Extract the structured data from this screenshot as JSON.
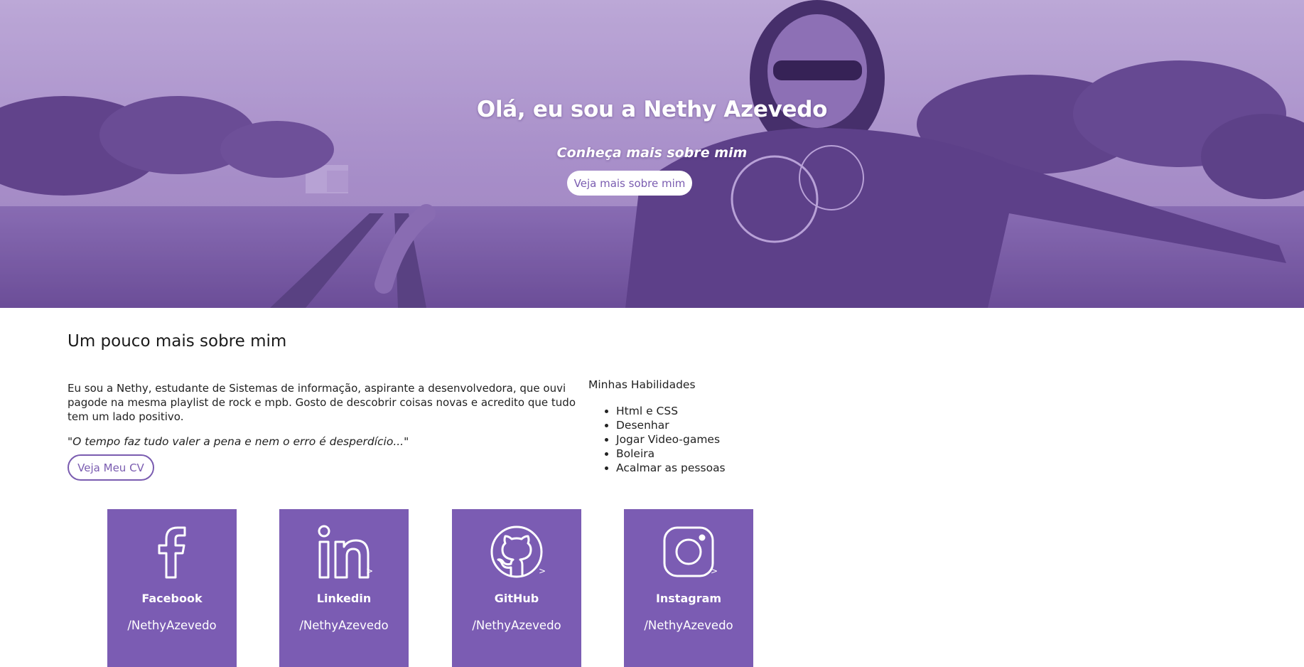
{
  "hero": {
    "title": "Olá, eu sou a Nethy Azevedo",
    "subtitle": "Conheça mais sobre mim",
    "button_label": "Veja mais sobre mim"
  },
  "about": {
    "heading": "Um pouco mais sobre mim",
    "description": "Eu sou a Nethy, estudante de Sistemas de informação, aspirante a desenvolvedora, que ouvi pagode na mesma playlist de rock e mpb. Gosto de descobrir coisas novas e acredito que tudo tem um lado positivo.",
    "quote": "\"O tempo faz tudo valer a pena e nem o erro é desperdício...\"",
    "cv_button_label": "Veja Meu CV"
  },
  "skills": {
    "title": "Minhas Habilidades",
    "items": [
      "Html e CSS",
      "Desenhar",
      "Jogar Video-games",
      "Boleira",
      "Acalmar as pessoas"
    ]
  },
  "social": [
    {
      "name": "Facebook",
      "handle": "/NethyAzevedo",
      "icon": "facebook-icon",
      "arrow": ""
    },
    {
      "name": "Linkedin",
      "handle": "/NethyAzevedo",
      "icon": "linkedin-icon",
      "arrow": ">"
    },
    {
      "name": "GitHub",
      "handle": "/NethyAzevedo",
      "icon": "github-icon",
      "arrow": ">"
    },
    {
      "name": "Instagram",
      "handle": "/NethyAzevedo",
      "icon": "instagram-icon",
      "arrow": ">"
    }
  ],
  "colors": {
    "accent": "#7b5cb3",
    "hero_tint": "#8a6bb8",
    "button_text": "#7a5cb0",
    "white": "#ffffff"
  }
}
